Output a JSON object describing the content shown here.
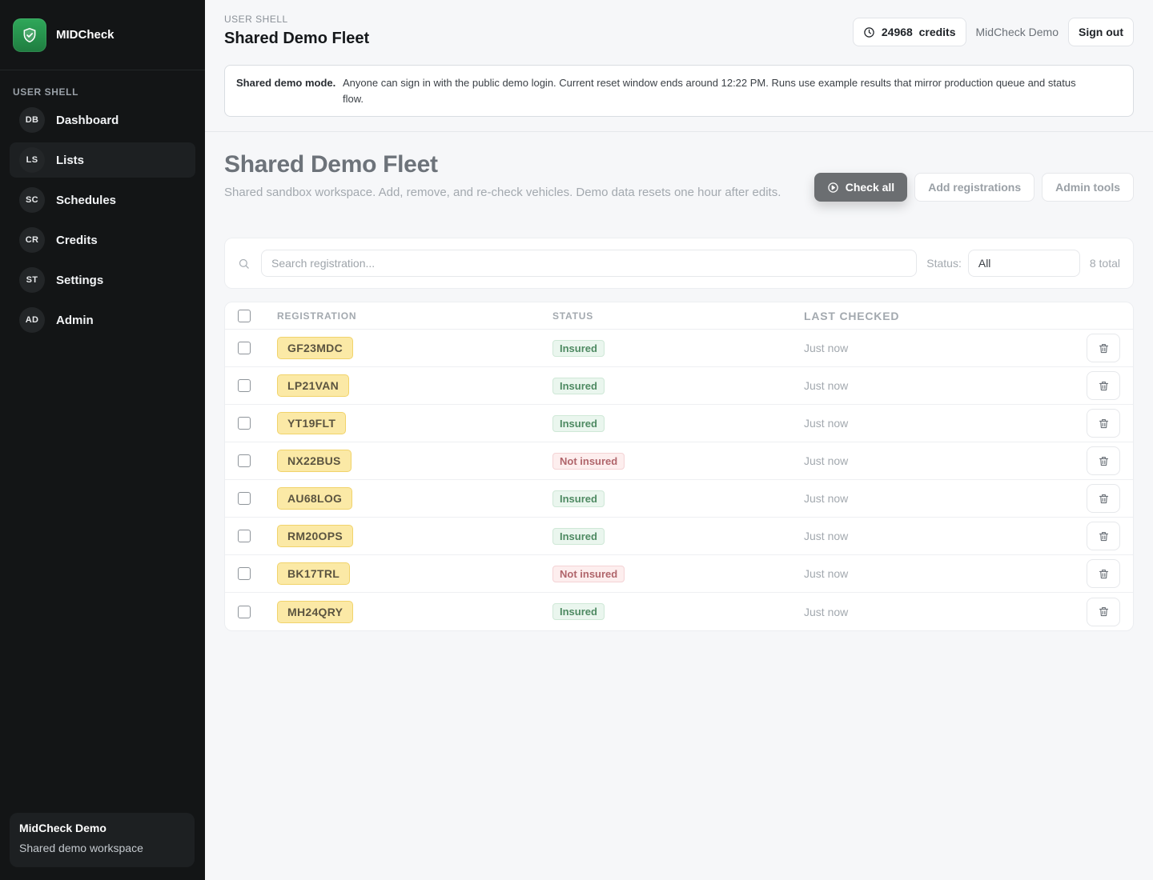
{
  "app": {
    "name": "MIDCheck"
  },
  "sidebar": {
    "section_label": "USER SHELL",
    "items": [
      {
        "abbr": "DB",
        "label": "Dashboard"
      },
      {
        "abbr": "LS",
        "label": "Lists"
      },
      {
        "abbr": "SC",
        "label": "Schedules"
      },
      {
        "abbr": "CR",
        "label": "Credits"
      },
      {
        "abbr": "ST",
        "label": "Settings"
      },
      {
        "abbr": "AD",
        "label": "Admin"
      }
    ],
    "active_index": 1,
    "footer": {
      "title": "MidCheck Demo",
      "subtitle": "Shared demo workspace"
    }
  },
  "topbar": {
    "eyebrow": "USER SHELL",
    "title": "Shared Demo Fleet",
    "credits_value": "24968",
    "credits_label": "credits",
    "user_name": "MidCheck Demo",
    "signout_label": "Sign out"
  },
  "notice": {
    "label": "Shared demo mode.",
    "text": "Anyone can sign in with the public demo login. Current reset window ends around 12:22 PM. Runs use example results that mirror production queue and status flow."
  },
  "page": {
    "title": "Shared Demo Fleet",
    "subtitle": "Shared sandbox workspace. Add, remove, and re-check vehicles. Demo data resets one hour after edits.",
    "actions": {
      "check_all": "Check all",
      "add": "Add registrations",
      "admin": "Admin tools"
    }
  },
  "filters": {
    "search_placeholder": "Search registration...",
    "status_label": "Status:",
    "status_value": "All",
    "total": "8 total"
  },
  "table": {
    "headers": {
      "registration": "REGISTRATION",
      "status": "STATUS",
      "last_checked": "LAST CHECKED"
    },
    "rows": [
      {
        "reg": "GF23MDC",
        "status": "Insured",
        "ok": true,
        "last": "Just now"
      },
      {
        "reg": "LP21VAN",
        "status": "Insured",
        "ok": true,
        "last": "Just now"
      },
      {
        "reg": "YT19FLT",
        "status": "Insured",
        "ok": true,
        "last": "Just now"
      },
      {
        "reg": "NX22BUS",
        "status": "Not insured",
        "ok": false,
        "last": "Just now"
      },
      {
        "reg": "AU68LOG",
        "status": "Insured",
        "ok": true,
        "last": "Just now"
      },
      {
        "reg": "RM20OPS",
        "status": "Insured",
        "ok": true,
        "last": "Just now"
      },
      {
        "reg": "BK17TRL",
        "status": "Not insured",
        "ok": false,
        "last": "Just now"
      },
      {
        "reg": "MH24QRY",
        "status": "Insured",
        "ok": true,
        "last": "Just now"
      }
    ]
  },
  "colors": {
    "accent_green": "#2fa85a",
    "sidebar_bg": "#131516",
    "plate_yellow": "#fbe9a6"
  }
}
